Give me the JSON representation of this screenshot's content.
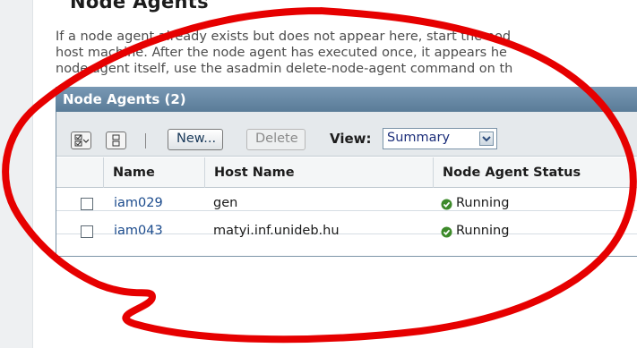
{
  "page": {
    "title": "Node Agents",
    "help_lines": [
      "If a node agent already exists but does not appear here, start the nod",
      "host machine. After the node agent has executed once, it appears he",
      "node agent itself, use the asadmin delete-node-agent command on th"
    ]
  },
  "table": {
    "title": "Node Agents (2)",
    "toolbar": {
      "new_label": "New...",
      "delete_label": "Delete",
      "view_label": "View:",
      "view_selected": "Summary"
    },
    "columns": [
      "Name",
      "Host Name",
      "Node Agent Status"
    ],
    "rows": [
      {
        "name": "iam029",
        "host": "gen",
        "status": "Running"
      },
      {
        "name": "iam043",
        "host": "matyi.inf.unideb.hu",
        "status": "Running"
      }
    ]
  },
  "colors": {
    "header_bg": "#6a8aa6",
    "link": "#1a4a8c",
    "status_ok": "#3d8a2a",
    "annotation": "#e60000"
  },
  "icons": {
    "select_all": "select-all-icon",
    "deselect_all": "deselect-all-icon",
    "status": "check-circle-icon",
    "dropdown": "chevron-down-icon"
  }
}
